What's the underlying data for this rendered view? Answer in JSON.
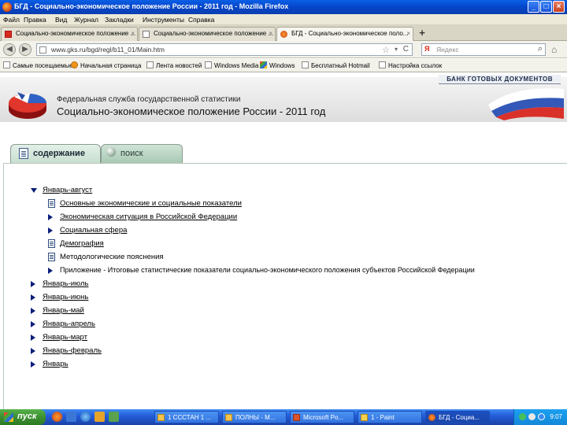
{
  "window": {
    "title": "БГД - Социально-экономическое положение России - 2011 год - Mozilla Firefox",
    "min": "_",
    "max": "□",
    "close": "×"
  },
  "menu": [
    "Файл",
    "Правка",
    "Вид",
    "Журнал",
    "Закладки",
    "Инструменты",
    "Справка"
  ],
  "tabs": [
    {
      "label": "Социально-экономическое положение ...",
      "close": "×"
    },
    {
      "label": "Социально-экономическое положение ...",
      "close": "×"
    },
    {
      "label": "БГД - Социально-экономическое поло...",
      "close": "×"
    }
  ],
  "new_tab": "+",
  "nav": {
    "back": "◀",
    "forward": "▶",
    "url": "www.gks.ru/bgd/regl/b11_01/Main.htm",
    "star": "☆",
    "dropdown": "▾",
    "reload": "C",
    "search_engine": "Я",
    "search_placeholder": "Яндекс",
    "search_icon": "⌕",
    "home": "⌂"
  },
  "bookmarks": [
    {
      "label": "Самые посещаемые",
      "icon": "page"
    },
    {
      "label": "Начальная страница",
      "icon": "orange"
    },
    {
      "label": "Лента новостей",
      "icon": "page"
    },
    {
      "label": "Windows Media",
      "icon": "page"
    },
    {
      "label": "Windows",
      "icon": "win"
    },
    {
      "label": "Бесплатный Hotmail",
      "icon": "page"
    },
    {
      "label": "Настройка ссылок",
      "icon": "page"
    }
  ],
  "header": {
    "bank_label": "БАНК ГОТОВЫХ ДОКУМЕНТОВ",
    "agency": "Федеральная служба государственной статистики",
    "title": "Социально-экономическое положение России - 2011 год"
  },
  "content_tabs": {
    "contents": "содержание",
    "search": "поиск"
  },
  "tree": [
    {
      "label": "Январь-август",
      "icon": "expanded",
      "level": 0
    },
    {
      "label": "Основные экономические и социальные показатели",
      "icon": "doc",
      "level": 1
    },
    {
      "label": "Экономическая ситуация в Российской Федерации",
      "icon": "collapsed",
      "level": 1
    },
    {
      "label": "Социальная сфера",
      "icon": "collapsed",
      "level": 1
    },
    {
      "label": "Демография",
      "icon": "doc",
      "level": 1
    },
    {
      "label": "Методологические пояснения",
      "icon": "doc",
      "level": 1
    },
    {
      "label": "Приложение - Итоговые статистические показатели социально-экономического положения субъектов Российской Федерации",
      "icon": "collapsed",
      "level": 1
    },
    {
      "label": "Январь-июль",
      "icon": "collapsed",
      "level": 0
    },
    {
      "label": "Январь-июнь",
      "icon": "collapsed",
      "level": 0
    },
    {
      "label": "Январь-май",
      "icon": "collapsed",
      "level": 0
    },
    {
      "label": "Январь-апрель",
      "icon": "collapsed",
      "level": 0
    },
    {
      "label": "Январь-март",
      "icon": "collapsed",
      "level": 0
    },
    {
      "label": "Январь-февраль",
      "icon": "collapsed",
      "level": 0
    },
    {
      "label": "Январь",
      "icon": "collapsed",
      "level": 0
    }
  ],
  "taskbar": {
    "start": "пуск",
    "tasks": [
      "1 СССТАН 1 ...",
      "ПОЛНЫ - М...",
      "Microsoft Po...",
      "1 - Paint",
      "БГД - Социа..."
    ],
    "clock": "9:07"
  }
}
